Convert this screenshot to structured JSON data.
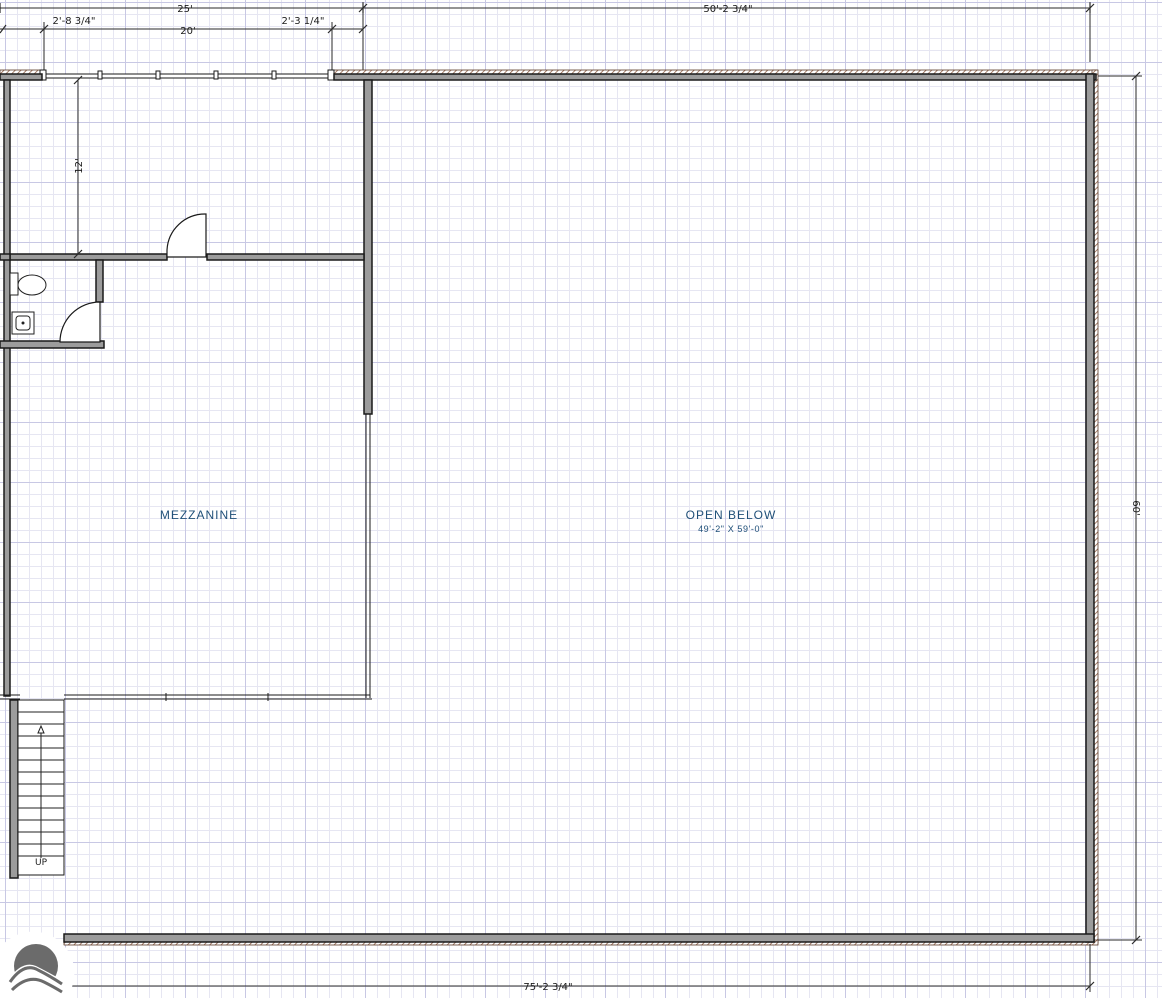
{
  "dimensions": {
    "top_left_total": "25'",
    "top_right_total": "50'-2 3/4\"",
    "top_left_seg": "2'-8 3/4\"",
    "top_mid_seg": "20'",
    "top_right_seg": "2'-3 1/4\"",
    "room_depth": "12'",
    "right_height": "60'",
    "bottom_total": "75'-2 3/4\""
  },
  "rooms": {
    "mezzanine": {
      "label": "MEZZANINE"
    },
    "open_below": {
      "label": "OPEN BELOW",
      "size": "49'-2\" X 59'-0\""
    }
  },
  "stair": {
    "label": "UP"
  },
  "colors": {
    "wall_fill": "#9c9c9c",
    "wall_outline": "#1a1a1a",
    "room_label": "#1f4f78",
    "grid_major": "#c8c8e4",
    "grid_minor": "#e6e6f2",
    "exterior_hatch": "#8a5a40",
    "logo": "#6b6b6b"
  },
  "icons": {
    "logo": "mountain-sun-logo-icon"
  }
}
